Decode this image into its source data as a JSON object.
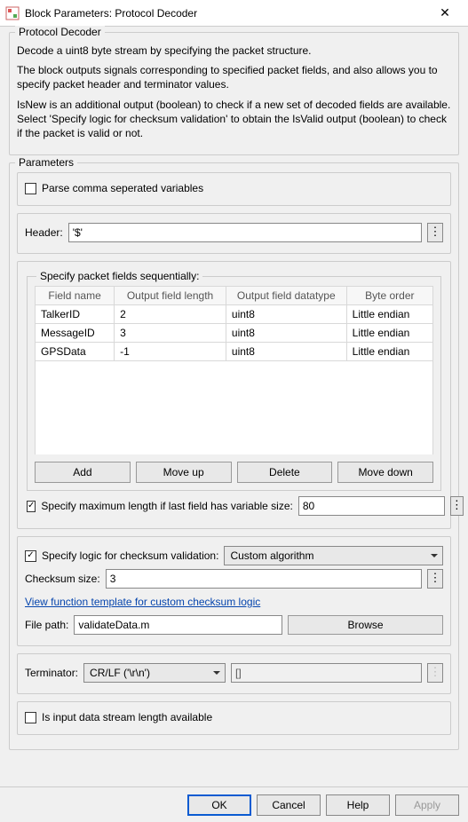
{
  "window": {
    "title": "Block Parameters: Protocol Decoder"
  },
  "desc": {
    "legend": "Protocol Decoder",
    "p1": "Decode a uint8 byte stream by specifying the packet structure.",
    "p2": "The block outputs signals corresponding to specified packet fields, and also allows you to specify packet header and terminator values.",
    "p3": "IsNew is an additional output (boolean) to check if a new set of decoded fields are available. Select 'Specify logic for checksum validation' to obtain the IsValid output (boolean) to check if the packet is valid or not."
  },
  "params": {
    "legend": "Parameters",
    "csv_label": "Parse comma seperated variables",
    "csv_checked": false,
    "header_label": "Header:",
    "header_value": "'$'",
    "fields_legend": "Specify packet fields sequentially:",
    "columns": {
      "c0": "Field name",
      "c1": "Output field length",
      "c2": "Output field datatype",
      "c3": "Byte order"
    },
    "rows": [
      {
        "name": "TalkerID",
        "len": "2",
        "dt": "uint8",
        "bo": "Little endian"
      },
      {
        "name": "MessageID",
        "len": "3",
        "dt": "uint8",
        "bo": "Little endian"
      },
      {
        "name": "GPSData",
        "len": "-1",
        "dt": "uint8",
        "bo": "Little endian"
      }
    ],
    "btn_add": "Add",
    "btn_up": "Move up",
    "btn_del": "Delete",
    "btn_down": "Move down",
    "maxlen_checked": true,
    "maxlen_label": "Specify maximum length if last field has variable size:",
    "maxlen_value": "80",
    "chksum_checked": true,
    "chksum_label": "Specify logic for checksum validation:",
    "chksum_algo": "Custom algorithm",
    "chksum_size_label": "Checksum size:",
    "chksum_size_value": "3",
    "link_text": "View function template for custom checksum logic",
    "filepath_label": "File path:",
    "filepath_value": "validateData.m",
    "browse": "Browse",
    "term_label": "Terminator:",
    "term_value": "CR/LF ('\\r\\n')",
    "term_extra": "[]",
    "stream_checked": false,
    "stream_label": "Is input data stream length available"
  },
  "buttons": {
    "ok": "OK",
    "cancel": "Cancel",
    "help": "Help",
    "apply": "Apply"
  }
}
